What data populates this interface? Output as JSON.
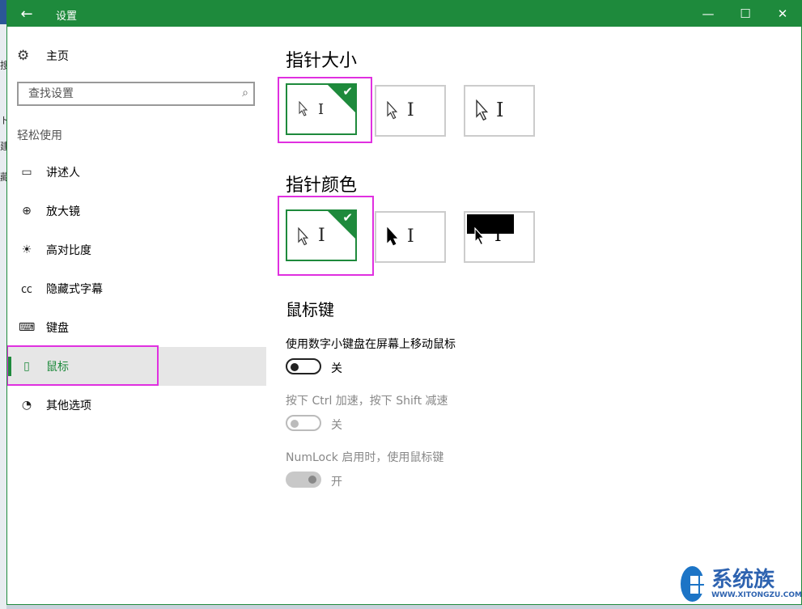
{
  "bg": {
    "chars": [
      "搜",
      "ト",
      "建",
      "藏"
    ]
  },
  "titlebar": {
    "back_icon": "←",
    "title": "设置",
    "min_icon": "—",
    "max_icon": "☐",
    "close_icon": "✕"
  },
  "sidebar": {
    "home_icon": "⚙",
    "home": "主页",
    "search_placeholder": "查找设置",
    "search_icon": "⌕",
    "section": "轻松使用",
    "items": [
      {
        "label": "讲述人",
        "icon": "▭",
        "icon_name": "narrator-icon"
      },
      {
        "label": "放大镜",
        "icon": "⊕",
        "icon_name": "magnifier-icon"
      },
      {
        "label": "高对比度",
        "icon": "☀",
        "icon_name": "high-contrast-icon"
      },
      {
        "label": "隐藏式字幕",
        "icon": "㏄",
        "icon_name": "closed-captions-icon"
      },
      {
        "label": "键盘",
        "icon": "⌨",
        "icon_name": "keyboard-icon"
      },
      {
        "label": "鼠标",
        "icon": "▯",
        "icon_name": "mouse-icon"
      },
      {
        "label": "其他选项",
        "icon": "◔",
        "icon_name": "other-options-icon"
      }
    ],
    "active_index": 5
  },
  "main": {
    "pointer_size": {
      "heading": "指针大小",
      "selected": 0
    },
    "pointer_color": {
      "heading": "指针颜色",
      "selected": 0
    },
    "mouse_keys": {
      "heading": "鼠标键",
      "toggle1": {
        "label": "使用数字小键盘在屏幕上移动鼠标",
        "state": "关"
      },
      "toggle2": {
        "label": "按下 Ctrl 加速，按下 Shift 减速",
        "state": "关"
      },
      "toggle3": {
        "label": "NumLock 启用时，使用鼠标键",
        "state": "开"
      }
    }
  },
  "checkmark": "✔",
  "ibeam": "I",
  "watermark": {
    "big": "系统族",
    "small": "WWW.XITONGZU.COM"
  },
  "colors": {
    "accent": "#1e8a3c",
    "highlight": "#e030e0"
  }
}
